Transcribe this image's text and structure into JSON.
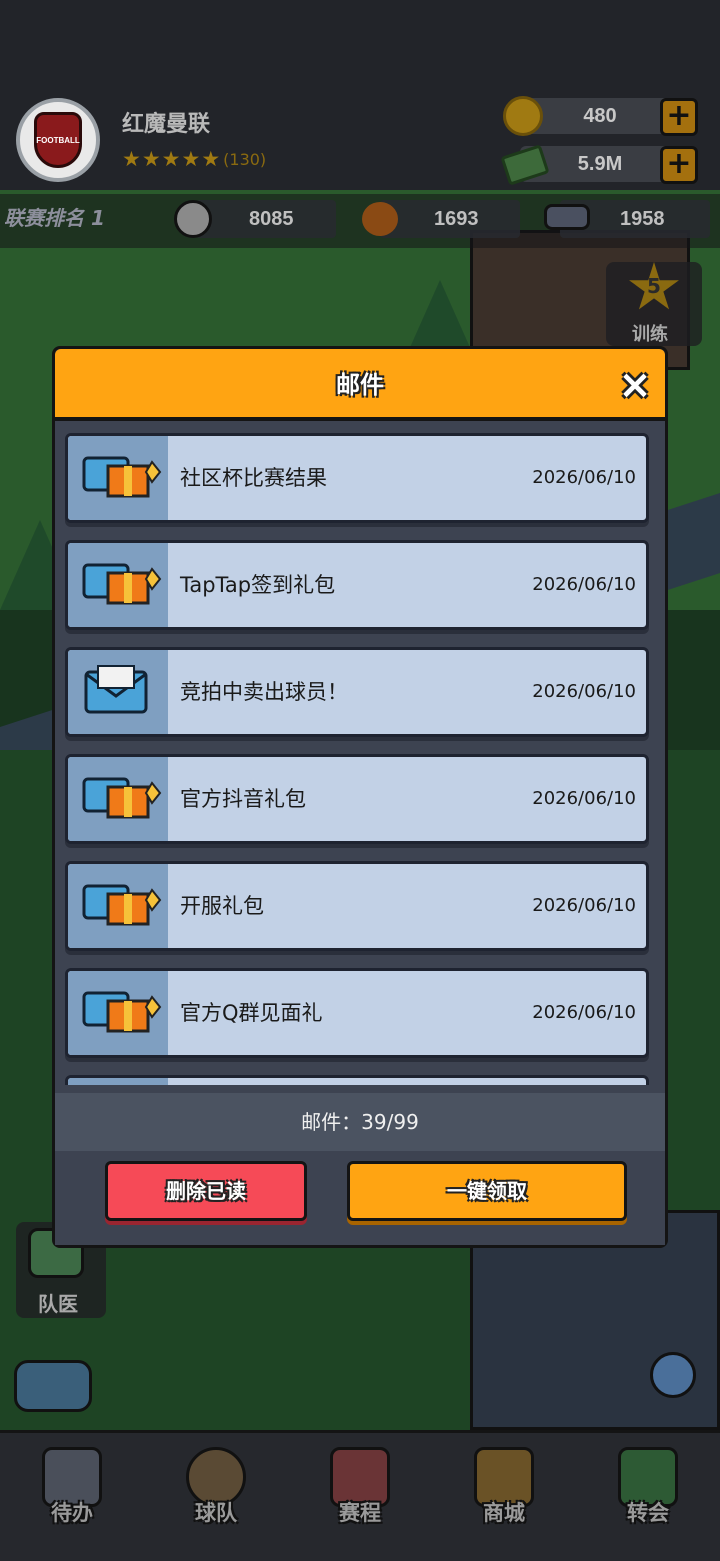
{
  "header": {
    "club_name": "红魔曼联",
    "avatar_badge_text": "FOOTBALL",
    "star_count": "(130)",
    "rating_stars": 5,
    "coins": "480",
    "cash": "5.9M"
  },
  "stats": {
    "league_rank": "联赛排名 1",
    "fans": "8085",
    "health": "1693",
    "training": "1958"
  },
  "side_panel": {
    "training_level": "5",
    "training_label": "训练",
    "team_doctor": "队医"
  },
  "modal": {
    "title": "邮件",
    "close_icon": "×",
    "count_label": "邮件：39/99",
    "delete_read": "删除已读",
    "claim_all": "一键领取",
    "mails": [
      {
        "title": "社区杯比赛结果",
        "date": "2026/06/10",
        "icon": "gift-mail-icon"
      },
      {
        "title": "TapTap签到礼包",
        "date": "2026/06/10",
        "icon": "gift-mail-icon"
      },
      {
        "title": "竞拍中卖出球员！",
        "date": "2026/06/10",
        "icon": "mail-icon"
      },
      {
        "title": "官方抖音礼包",
        "date": "2026/06/10",
        "icon": "gift-mail-icon"
      },
      {
        "title": "开服礼包",
        "date": "2026/06/10",
        "icon": "gift-mail-icon"
      },
      {
        "title": "官方Q群见面礼",
        "date": "2026/06/10",
        "icon": "gift-mail-icon"
      }
    ]
  },
  "nav": [
    {
      "label": "待办",
      "icon": "clipboard-icon",
      "color": "#4a4f5a"
    },
    {
      "label": "球队",
      "icon": "team-icon",
      "color": "#5a4a34"
    },
    {
      "label": "赛程",
      "icon": "calendar-icon",
      "color": "#6a3436"
    },
    {
      "label": "商城",
      "icon": "basket-icon",
      "color": "#6a5226"
    },
    {
      "label": "转会",
      "icon": "transfer-arrows-icon",
      "color": "#2d5a34"
    }
  ],
  "colors": {
    "accent": "#ffa412",
    "danger": "#f64a57",
    "mail_item_bg": "#c2d1e6"
  }
}
